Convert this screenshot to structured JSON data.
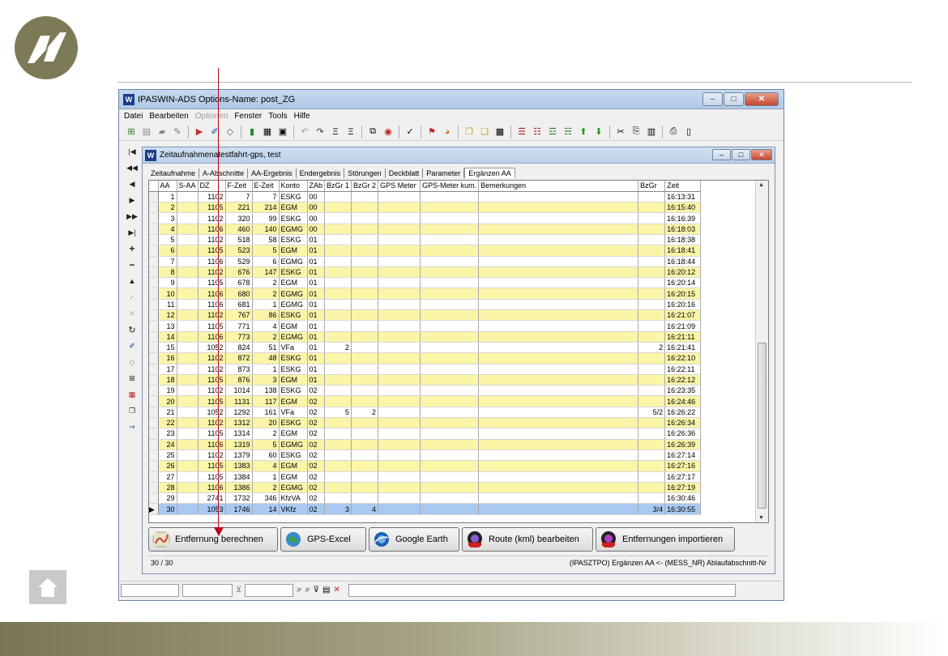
{
  "app": {
    "title": "IPASWIN-ADS  Options-Name: post_ZG",
    "window_buttons": [
      "–",
      "□",
      "✕"
    ]
  },
  "menu": [
    {
      "label": "Datei",
      "disabled": false
    },
    {
      "label": "Bearbeiten",
      "disabled": false
    },
    {
      "label": "Optionen",
      "disabled": true
    },
    {
      "label": "Fenster",
      "disabled": false
    },
    {
      "label": "Tools",
      "disabled": false
    },
    {
      "label": "Hilfe",
      "disabled": false
    }
  ],
  "child": {
    "title": "Zeitaufnahmenatestfahrt-gps, test",
    "tabs": [
      "Zeitaufnahme",
      "A-Abschnitte",
      "AA-Ergebnis",
      "Endergebnis",
      "Störungen",
      "Deckblatt",
      "Parameter",
      "Ergänzen AA"
    ],
    "active_tab": "Ergänzen AA"
  },
  "table": {
    "columns": [
      "AA",
      "S-AA",
      "DZ",
      "F-Zeit",
      "E-Zeit",
      "Konto",
      "ZAb",
      "BzGr 1",
      "BzGr 2",
      "GPS Meter",
      "GPS-Meter kum.",
      "Bemerkungen",
      "BzGr",
      "Zeit"
    ],
    "rows": [
      [
        "1",
        "",
        "1102",
        "7",
        "7",
        "ESKG",
        "00",
        "",
        "",
        "",
        "",
        "",
        "",
        "16:13:31"
      ],
      [
        "2",
        "",
        "1105",
        "221",
        "214",
        "EGM",
        "00",
        "",
        "",
        "",
        "",
        "",
        "",
        "16:15:40"
      ],
      [
        "3",
        "",
        "1102",
        "320",
        "99",
        "ESKG",
        "00",
        "",
        "",
        "",
        "",
        "",
        "",
        "16:16:39"
      ],
      [
        "4",
        "",
        "1106",
        "460",
        "140",
        "EGMG",
        "00",
        "",
        "",
        "",
        "",
        "",
        "",
        "16:18:03"
      ],
      [
        "5",
        "",
        "1102",
        "518",
        "58",
        "ESKG",
        "01",
        "",
        "",
        "",
        "",
        "",
        "",
        "16:18:38"
      ],
      [
        "6",
        "",
        "1105",
        "523",
        "5",
        "EGM",
        "01",
        "",
        "",
        "",
        "",
        "",
        "",
        "16:18:41"
      ],
      [
        "7",
        "",
        "1106",
        "529",
        "6",
        "EGMG",
        "01",
        "",
        "",
        "",
        "",
        "",
        "",
        "16:18:44"
      ],
      [
        "8",
        "",
        "1102",
        "676",
        "147",
        "ESKG",
        "01",
        "",
        "",
        "",
        "",
        "",
        "",
        "16:20:12"
      ],
      [
        "9",
        "",
        "1105",
        "678",
        "2",
        "EGM",
        "01",
        "",
        "",
        "",
        "",
        "",
        "",
        "16:20:14"
      ],
      [
        "10",
        "",
        "1106",
        "680",
        "2",
        "EGMG",
        "01",
        "",
        "",
        "",
        "",
        "",
        "",
        "16:20:15"
      ],
      [
        "11",
        "",
        "1106",
        "681",
        "1",
        "EGMG",
        "01",
        "",
        "",
        "",
        "",
        "",
        "",
        "16:20:16"
      ],
      [
        "12",
        "",
        "1102",
        "767",
        "86",
        "ESKG",
        "01",
        "",
        "",
        "",
        "",
        "",
        "",
        "16:21:07"
      ],
      [
        "13",
        "",
        "1105",
        "771",
        "4",
        "EGM",
        "01",
        "",
        "",
        "",
        "",
        "",
        "",
        "16:21:09"
      ],
      [
        "14",
        "",
        "1106",
        "773",
        "2",
        "EGMG",
        "01",
        "",
        "",
        "",
        "",
        "",
        "",
        "16:21:11"
      ],
      [
        "15",
        "",
        "1052",
        "824",
        "51",
        "VFa",
        "01",
        "2",
        "",
        "",
        "",
        "",
        "2",
        "16:21:41"
      ],
      [
        "16",
        "",
        "1102",
        "872",
        "48",
        "ESKG",
        "01",
        "",
        "",
        "",
        "",
        "",
        "",
        "16:22:10"
      ],
      [
        "17",
        "",
        "1102",
        "873",
        "1",
        "ESKG",
        "01",
        "",
        "",
        "",
        "",
        "",
        "",
        "16:22:11"
      ],
      [
        "18",
        "",
        "1105",
        "876",
        "3",
        "EGM",
        "01",
        "",
        "",
        "",
        "",
        "",
        "",
        "16:22:12"
      ],
      [
        "19",
        "",
        "1102",
        "1014",
        "138",
        "ESKG",
        "02",
        "",
        "",
        "",
        "",
        "",
        "",
        "16:23:35"
      ],
      [
        "20",
        "",
        "1105",
        "1131",
        "117",
        "EGM",
        "02",
        "",
        "",
        "",
        "",
        "",
        "",
        "16:24:46"
      ],
      [
        "21",
        "",
        "1052",
        "1292",
        "161",
        "VFa",
        "02",
        "5",
        "2",
        "",
        "",
        "",
        "5/2",
        "16:26:22"
      ],
      [
        "22",
        "",
        "1102",
        "1312",
        "20",
        "ESKG",
        "02",
        "",
        "",
        "",
        "",
        "",
        "",
        "16:26:34"
      ],
      [
        "23",
        "",
        "1105",
        "1314",
        "2",
        "EGM",
        "02",
        "",
        "",
        "",
        "",
        "",
        "",
        "16:26:36"
      ],
      [
        "24",
        "",
        "1106",
        "1319",
        "5",
        "EGMG",
        "02",
        "",
        "",
        "",
        "",
        "",
        "",
        "16:26:39"
      ],
      [
        "25",
        "",
        "1102",
        "1379",
        "60",
        "ESKG",
        "02",
        "",
        "",
        "",
        "",
        "",
        "",
        "16:27:14"
      ],
      [
        "26",
        "",
        "1105",
        "1383",
        "4",
        "EGM",
        "02",
        "",
        "",
        "",
        "",
        "",
        "",
        "16:27:16"
      ],
      [
        "27",
        "",
        "1105",
        "1384",
        "1",
        "EGM",
        "02",
        "",
        "",
        "",
        "",
        "",
        "",
        "16:27:17"
      ],
      [
        "28",
        "",
        "1106",
        "1386",
        "2",
        "EGMG",
        "02",
        "",
        "",
        "",
        "",
        "",
        "",
        "16:27:19"
      ],
      [
        "29",
        "",
        "2741",
        "1732",
        "346",
        "KfzVA",
        "02",
        "",
        "",
        "",
        "",
        "",
        "",
        "16:30:46"
      ],
      [
        "30",
        "",
        "1053",
        "1746",
        "14",
        "VKfz",
        "02",
        "3",
        "4",
        "",
        "",
        "",
        "3/4",
        "16:30:55"
      ]
    ],
    "selected_row": "30"
  },
  "buttons": {
    "entfernung": "Entfernung berechnen",
    "gps_excel": "GPS-Excel",
    "google_earth": "Google Earth",
    "route": "Route (kml) bearbeiten",
    "import": "Entfernungen importieren"
  },
  "status": {
    "left": "30 / 30",
    "right": "(IPASZTPO) Ergänzen AA <- (MESS_NR) Ablaufabschnitt-Nr"
  },
  "colors": {
    "row_highlight": "#fbf5a8",
    "row_selected": "#a9c9f1",
    "annotation_arrow": "#c0001a"
  }
}
